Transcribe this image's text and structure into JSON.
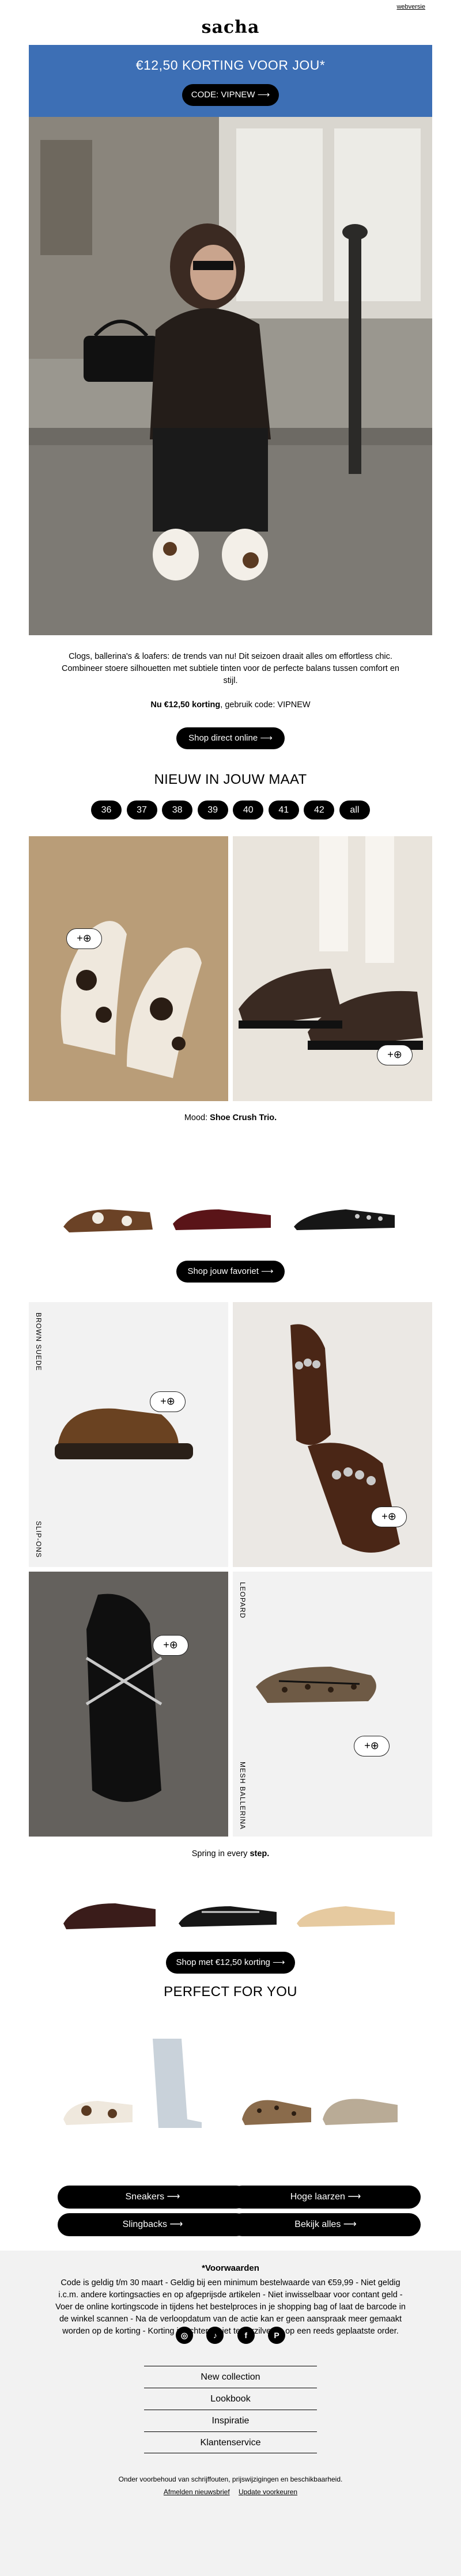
{
  "header": {
    "weblink": "webversie",
    "logo": "sacha"
  },
  "banner": {
    "headline": "€12,50 KORTING VOOR JOU*",
    "code_button": "CODE: VIPNEW ⟶",
    "bg_color": "#3d6fb5"
  },
  "intro": {
    "text": "Clogs, ballerina's & loafers: de trends van nu! Dit seizoen draait alles om effortless chic. Combineer stoere silhouetten met subtiele tinten voor de perfecte balans tussen comfort en stijl.",
    "offer_bold": "Nu €12,50 korting",
    "offer_rest": ", gebruik code: VIPNEW",
    "cta": "Shop direct online ⟶"
  },
  "sizes": {
    "title": "NIEUW IN JOUW MAAT",
    "items": [
      "36",
      "37",
      "38",
      "39",
      "40",
      "41",
      "42",
      "all"
    ]
  },
  "grid1": {
    "add_label": "+⊕",
    "caption_prefix": "Mood: ",
    "caption_bold": "Shoe Crush Trio."
  },
  "favorite": {
    "cta": "Shop jouw favoriet ⟶"
  },
  "grid2": {
    "label_brown_suede": "BROWN SUEDE",
    "label_slip_ons": "SLIP-ONS",
    "label_leopard": "LEOPARD",
    "label_mesh": "MESH BALLERINA",
    "caption_prefix": "Spring in every ",
    "caption_bold": "step."
  },
  "promo2": {
    "cta": "Shop met €12,50 korting ⟶"
  },
  "perfect": {
    "title": "PERFECT FOR YOU",
    "buttons": [
      "Sneakers ⟶",
      "Hoge laarzen ⟶",
      "Slingbacks ⟶",
      "Bekijk alles ⟶"
    ]
  },
  "footer": {
    "terms_title": "*Voorwaarden",
    "terms": "Code is geldig t/m 30 maart - Geldig bij een minimum bestelwaarde van €59,99 - Niet geldig i.c.m. andere kortingsacties en op afgeprijsde artikelen - Niet inwisselbaar voor contant geld - Voer de online kortingscode in tijdens het bestelproces in je shopping bag of laat de barcode in de winkel scannen - Na de verloopdatum van de actie kan er geen aanspraak meer gemaakt worden op de korting - Korting is achteraf niet te verzilveren op een reeds geplaatste order.",
    "socials": [
      "instagram-icon",
      "tiktok-icon",
      "facebook-icon",
      "pinterest-icon"
    ],
    "nav": [
      "New collection",
      "Lookbook",
      "Inspiratie",
      "Klantenservice"
    ],
    "fine_print": "Onder voorbehoud van schrijffouten, prijswijzigingen en beschikbaarheid.",
    "links": [
      "Afmelden nieuwsbrief",
      "Update voorkeuren"
    ]
  }
}
